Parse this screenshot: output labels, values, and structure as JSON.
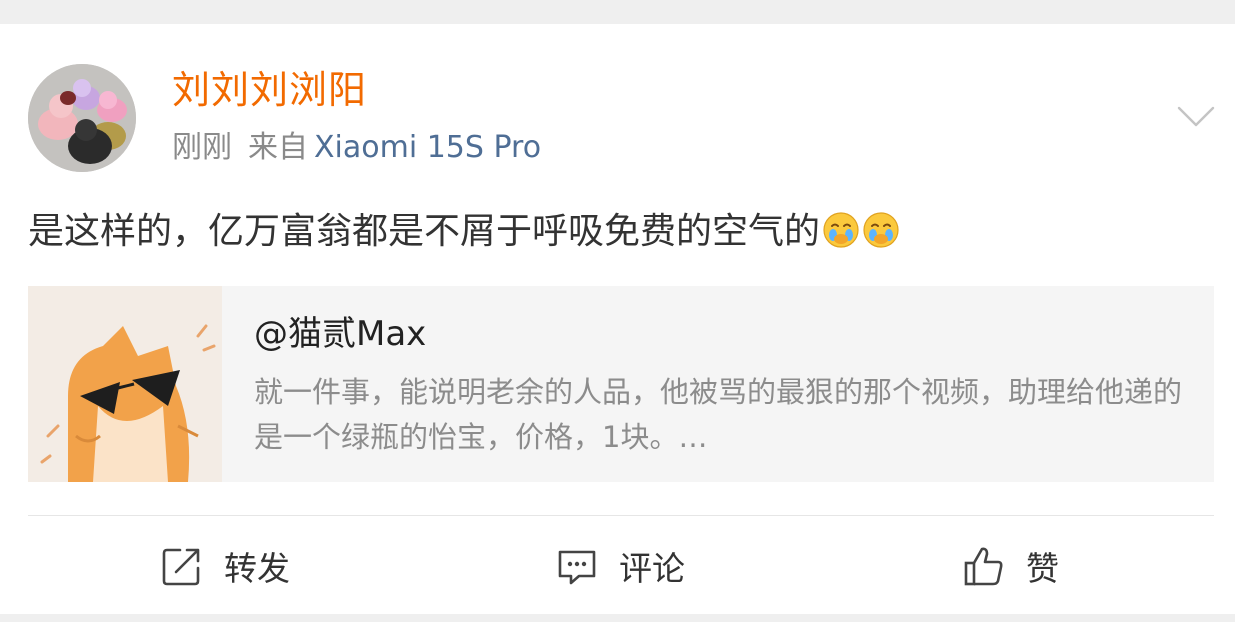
{
  "post": {
    "username": "刘刘刘浏阳",
    "time": "刚刚",
    "source_prefix": "来自",
    "device": "Xiaomi 15S Pro",
    "text": "是这样的，亿万富翁都是不屑于呼吸免费的空气的",
    "emojis": [
      "crying-emoji",
      "crying-emoji"
    ]
  },
  "repost": {
    "author": "@猫贰Max",
    "body": "就一件事，能说明老余的人品，他被骂的最狠的那个视频，助理给他递的是一个绿瓶的怡宝，价格，1块。…"
  },
  "actions": {
    "repost_label": "转发",
    "comment_label": "评论",
    "like_label": "赞"
  },
  "icons": {
    "menu": "chevron-down-icon",
    "repost": "share-icon",
    "comment": "comment-icon",
    "like": "thumbs-up-icon"
  },
  "colors": {
    "username": "#f26a00",
    "device": "#4f6e95",
    "meta": "#8a8a8a",
    "repost_bg": "#f5f5f5"
  }
}
